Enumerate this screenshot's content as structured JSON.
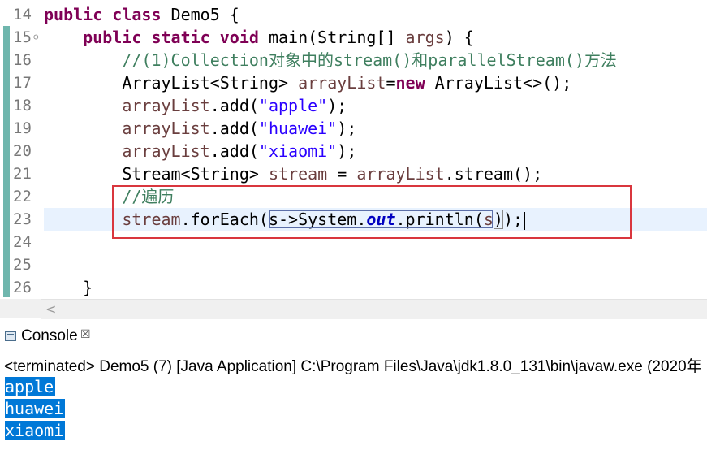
{
  "editor": {
    "lines": [
      {
        "num": "14",
        "segments": [
          {
            "t": "public class ",
            "c": "kw"
          },
          {
            "t": "Demo5 {",
            "c": ""
          }
        ]
      },
      {
        "num": "15",
        "fold": "⊖",
        "segments": [
          {
            "t": "    ",
            "c": ""
          },
          {
            "t": "public static void ",
            "c": "kw"
          },
          {
            "t": "main(String[] ",
            "c": ""
          },
          {
            "t": "args",
            "c": "vr"
          },
          {
            "t": ") {",
            "c": ""
          }
        ]
      },
      {
        "num": "16",
        "segments": [
          {
            "t": "        //(1)Collection",
            "c": "cm"
          },
          {
            "t": "对象中的",
            "c": "cm cjk"
          },
          {
            "t": "stream()",
            "c": "cm"
          },
          {
            "t": "和",
            "c": "cm cjk"
          },
          {
            "t": "parallelStream()",
            "c": "cm"
          },
          {
            "t": "方法",
            "c": "cm cjk"
          }
        ]
      },
      {
        "num": "17",
        "segments": [
          {
            "t": "        ArrayList<String> ",
            "c": ""
          },
          {
            "t": "arrayList",
            "c": "vr"
          },
          {
            "t": "=",
            "c": ""
          },
          {
            "t": "new ",
            "c": "kw"
          },
          {
            "t": "ArrayList<>();",
            "c": ""
          }
        ]
      },
      {
        "num": "18",
        "segments": [
          {
            "t": "        ",
            "c": ""
          },
          {
            "t": "arrayList",
            "c": "vr"
          },
          {
            "t": ".add(",
            "c": ""
          },
          {
            "t": "\"apple\"",
            "c": "st"
          },
          {
            "t": ");",
            "c": ""
          }
        ]
      },
      {
        "num": "19",
        "segments": [
          {
            "t": "        ",
            "c": ""
          },
          {
            "t": "arrayList",
            "c": "vr"
          },
          {
            "t": ".add(",
            "c": ""
          },
          {
            "t": "\"huawei\"",
            "c": "st"
          },
          {
            "t": ");",
            "c": ""
          }
        ]
      },
      {
        "num": "20",
        "segments": [
          {
            "t": "        ",
            "c": ""
          },
          {
            "t": "arrayList",
            "c": "vr"
          },
          {
            "t": ".add(",
            "c": ""
          },
          {
            "t": "\"xiaomi\"",
            "c": "st"
          },
          {
            "t": ");",
            "c": ""
          }
        ]
      },
      {
        "num": "21",
        "segments": [
          {
            "t": "        Stream<String> ",
            "c": ""
          },
          {
            "t": "stream",
            "c": "vr"
          },
          {
            "t": " = ",
            "c": ""
          },
          {
            "t": "arrayList",
            "c": "vr"
          },
          {
            "t": ".stream();",
            "c": ""
          }
        ]
      },
      {
        "num": "22",
        "segments": [
          {
            "t": "        //",
            "c": "cm"
          },
          {
            "t": "遍历",
            "c": "cm cjk"
          }
        ]
      },
      {
        "num": "23",
        "current": true,
        "segments": [
          {
            "t": "        ",
            "c": ""
          },
          {
            "t": "stream",
            "c": "vr"
          },
          {
            "t": ".forEach(",
            "c": ""
          },
          {
            "t": "s->System.",
            "c": "lambda-start"
          },
          {
            "t": "out",
            "c": "fl"
          },
          {
            "t": ".println(",
            "c": ""
          },
          {
            "t": "s",
            "c": "vr"
          },
          {
            "t": ")",
            "c": "bracket"
          },
          {
            "t": ");",
            "c": ""
          },
          {
            "t": "",
            "c": "caret"
          }
        ]
      },
      {
        "num": "24",
        "segments": []
      },
      {
        "num": "25",
        "segments": []
      },
      {
        "num": "26",
        "segments": [
          {
            "t": "    }",
            "c": ""
          }
        ]
      }
    ]
  },
  "scrollbar": {
    "left_arrow": "<"
  },
  "console": {
    "tab_title": "Console",
    "close_glyph": "☒",
    "status": "<terminated> Demo5 (7) [Java Application] C:\\Program Files\\Java\\jdk1.8.0_131\\bin\\javaw.exe (2020年",
    "output": [
      "apple ",
      "huawei",
      "xiaomi"
    ]
  }
}
